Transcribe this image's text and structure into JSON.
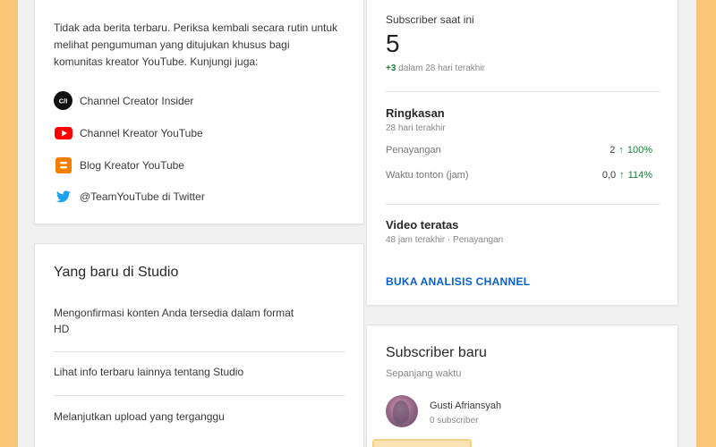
{
  "news": {
    "text": "Tidak ada berita terbaru. Periksa kembali secara rutin untuk melihat pengumuman yang ditujukan khusus bagi komunitas kreator YouTube. Kunjungi juga:",
    "links": [
      {
        "label": "Channel Creator Insider",
        "icon": "creator-insider-icon"
      },
      {
        "label": "Channel Kreator YouTube",
        "icon": "youtube-icon"
      },
      {
        "label": "Blog Kreator YouTube",
        "icon": "blogger-icon"
      },
      {
        "label": "@TeamYouTube di Twitter",
        "icon": "twitter-icon"
      }
    ],
    "ci_glyph": "C/I"
  },
  "studio": {
    "title": "Yang baru di Studio",
    "items": [
      "Mengonfirmasi konten Anda tersedia dalam format HD",
      "Lihat info terbaru lainnya tentang Studio",
      "Melanjutkan upload yang terganggu"
    ]
  },
  "analytics": {
    "subs_label": "Subscriber saat ini",
    "subs_count": "5",
    "growth_value": "+3",
    "growth_suffix": "dalam 28 hari terakhir",
    "summary_title": "Ringkasan",
    "summary_period": "28 hari terakhir",
    "metrics": [
      {
        "label": "Penayangan",
        "value": "2",
        "pct": "100%"
      },
      {
        "label": "Waktu tonton (jam)",
        "value": "0,0",
        "pct": "114%"
      }
    ],
    "top_title": "Video teratas",
    "top_sub": "48 jam terakhir · Penayangan",
    "open_link": "BUKA ANALISIS CHANNEL"
  },
  "new_subs": {
    "title": "Subscriber baru",
    "period": "Sepanjang waktu",
    "subscriber": {
      "name": "Gusti Afriansyah",
      "count": "0 subscriber"
    }
  },
  "colors": {
    "background": "#f9c677",
    "positive": "#188038",
    "link": "#065fd4",
    "youtube_red": "#ff0000",
    "blogger_orange": "#f57d00",
    "twitter_blue": "#1da1f2"
  }
}
